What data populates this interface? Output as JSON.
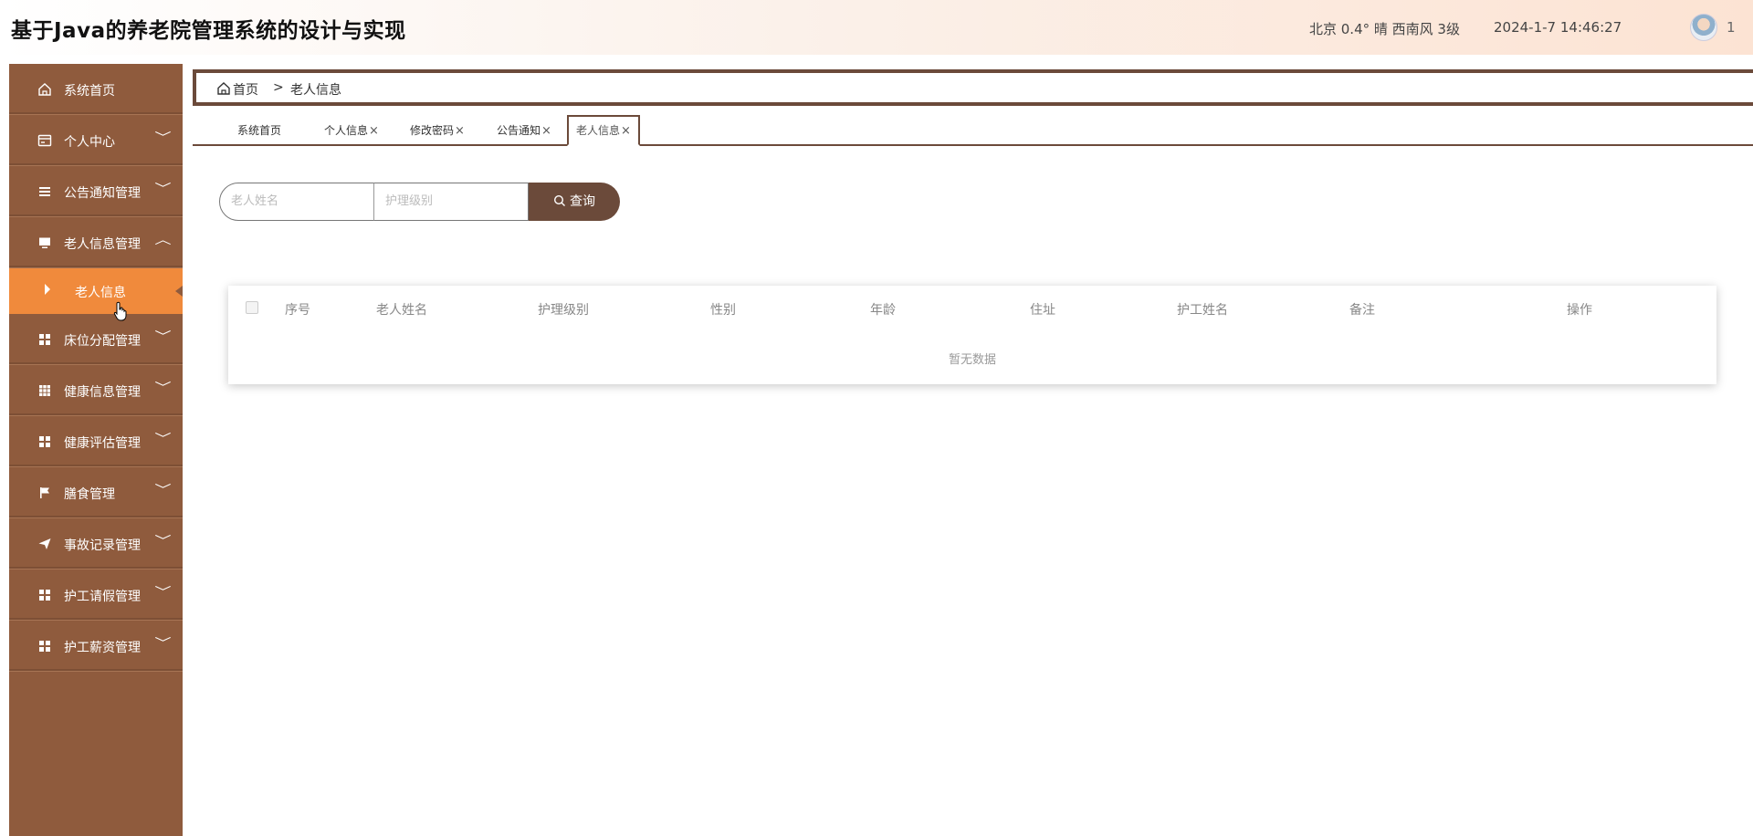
{
  "header": {
    "title": "基于Java的养老院管理系统的设计与实现",
    "weather": "北京  0.4°  晴  西南风  3级",
    "datetime": "2024-1-7 14:46:27",
    "user_count": "1"
  },
  "sidebar": {
    "items": [
      {
        "label": "系统首页",
        "icon": "home-icon"
      },
      {
        "label": "个人中心",
        "icon": "id-card-icon",
        "arrow": "﹀"
      },
      {
        "label": "公告通知管理",
        "icon": "list-icon",
        "arrow": "﹀"
      },
      {
        "label": "老人信息管理",
        "icon": "monitor-icon",
        "arrow": "︿"
      },
      {
        "label": "床位分配管理",
        "icon": "grid-icon",
        "arrow": "﹀"
      },
      {
        "label": "健康信息管理",
        "icon": "table-grid-icon",
        "arrow": "﹀"
      },
      {
        "label": "健康评估管理",
        "icon": "grid-icon",
        "arrow": "﹀"
      },
      {
        "label": "膳食管理",
        "icon": "flag-icon",
        "arrow": "﹀"
      },
      {
        "label": "事故记录管理",
        "icon": "send-icon",
        "arrow": "﹀"
      },
      {
        "label": "护工请假管理",
        "icon": "grid-icon",
        "arrow": "﹀"
      },
      {
        "label": "护工薪资管理",
        "icon": "grid-icon",
        "arrow": "﹀"
      }
    ],
    "active_sub": "老人信息"
  },
  "breadcrumb": {
    "home": "首页",
    "separator": ">",
    "current": "老人信息"
  },
  "tabs": [
    {
      "label": "系统首页",
      "closable": false
    },
    {
      "label": "个人信息",
      "closable": true
    },
    {
      "label": "修改密码",
      "closable": true
    },
    {
      "label": "公告通知",
      "closable": true
    },
    {
      "label": "老人信息",
      "closable": true,
      "active": true
    }
  ],
  "tab_close_glyph": "×",
  "search": {
    "name_placeholder": "老人姓名",
    "level_placeholder": "护理级别",
    "button_label": "查询"
  },
  "table": {
    "columns": [
      "序号",
      "老人姓名",
      "护理级别",
      "性别",
      "年龄",
      "住址",
      "护工姓名",
      "备注",
      "操作"
    ],
    "rows": [],
    "empty_text": "暂无数据"
  },
  "colors": {
    "sidebar_bg": "#8f5b3d",
    "active_item": "#f08a3c",
    "accent_dark": "#6b4a3a"
  }
}
